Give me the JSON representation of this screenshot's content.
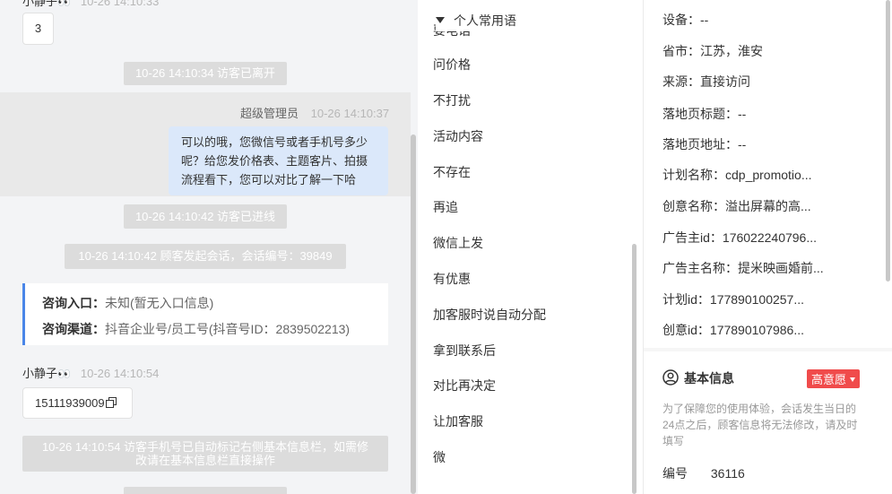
{
  "chat": {
    "top_visitor": {
      "name": "小静子",
      "time": "10-26 14:10:33",
      "message": "3"
    },
    "sys_left": "10-26 14:10:34 访客已离开",
    "agent": {
      "name": "超级管理员",
      "time": "10-26 14:10:37",
      "message_line1": "可以的哦，您微信号或者手机号多少",
      "message_line2": "呢？给您发价格表、主题客片、拍摄",
      "message_line3": "流程看下，您可以对比了解一下哈"
    },
    "sys_entered": "10-26 14:10:42 访客已进线",
    "sys_session": "10-26 14:10:42 顾客发起会话，会话编号：39849",
    "info_card": {
      "entry_label": "咨询入口：",
      "entry_value": "未知(暂无入口信息)",
      "channel_label": "咨询渠道：",
      "channel_value": "抖音企业号/员工号(抖音号ID：2839502213)"
    },
    "visitor2": {
      "name": "小静子",
      "time": "10-26 14:10:54",
      "message": "15111939009"
    },
    "sys_phone_line1": "10-26 14:10:54 访客手机号已自动标记右侧基本信息栏，如需修",
    "sys_phone_line2": "改请在基本信息栏直接操作"
  },
  "phrases": {
    "group_title": "个人常用语",
    "items": [
      "要电话",
      "问价格",
      "不打扰",
      "活动内容",
      "不存在",
      "再追",
      "微信上发",
      "有优惠",
      "加客服时说自动分配",
      "拿到联系后",
      "对比再决定",
      "让加客服",
      "微"
    ]
  },
  "detail": {
    "rows": [
      {
        "label": "设备：",
        "value": "--"
      },
      {
        "label": "省市：",
        "value": "江苏，淮安"
      },
      {
        "label": "来源：",
        "value": "直接访问"
      },
      {
        "label": "落地页标题：",
        "value": "--"
      },
      {
        "label": "落地页地址：",
        "value": "--"
      },
      {
        "label": "计划名称：",
        "value": "cdp_promotio..."
      },
      {
        "label": "创意名称：",
        "value": "溢出屏幕的高..."
      },
      {
        "label": "广告主id：",
        "value": "176022240796..."
      },
      {
        "label": "广告主名称：",
        "value": "提米映画婚前..."
      },
      {
        "label": "计划id：",
        "value": "177890100257..."
      },
      {
        "label": "创意id：",
        "value": "177890107986..."
      }
    ],
    "basic_info_title": "基本信息",
    "intent_badge": "高意愿",
    "notice": "为了保障您的使用体验，会话发生当日的24点之后，顾客信息将无法修改，请及时填写",
    "id_label": "编号",
    "id_value": "36116"
  },
  "icons": [
    "eyes-emoji",
    "copy-icon",
    "caret-down-icon",
    "user-circle-icon"
  ],
  "colors": {
    "accent": "#4a86e8",
    "agent_bubble": "#dbe8fa",
    "badge": "#f04b4b",
    "sys_pill": "#dcdcdc"
  }
}
